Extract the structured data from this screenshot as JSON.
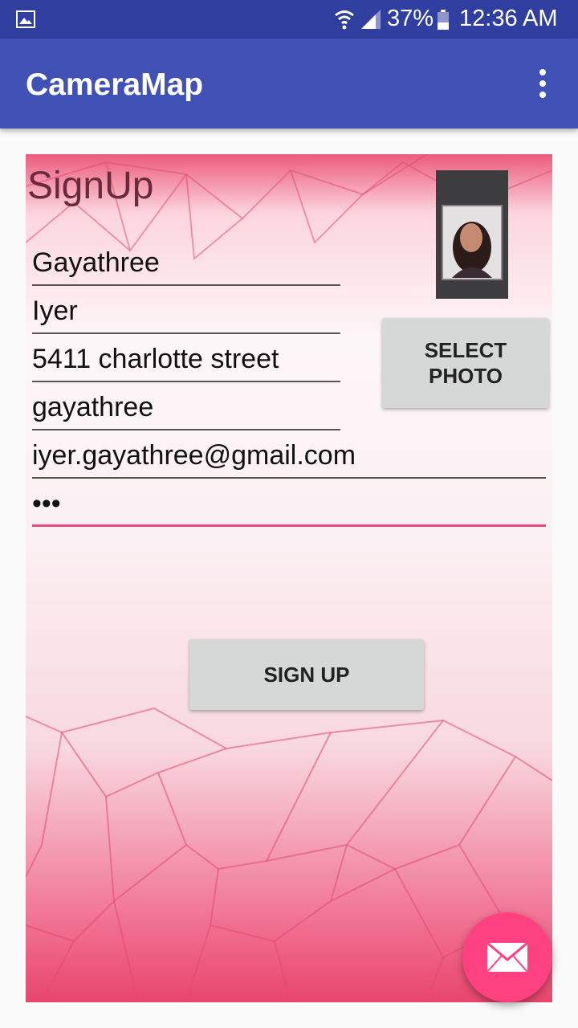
{
  "status_bar": {
    "battery_percent": "37%",
    "time": "12:36 AM",
    "icons": [
      "gallery-icon",
      "wifi-icon",
      "signal-icon",
      "battery-icon"
    ]
  },
  "app_bar": {
    "title": "CameraMap",
    "overflow_icon": "more-vert-icon"
  },
  "form": {
    "heading": "SignUp",
    "fields": {
      "first_name": "Gayathree",
      "last_name": "Iyer",
      "address": "5411 charlotte street",
      "username": "gayathree",
      "email": "iyer.gayathree@gmail.com",
      "password": "•••"
    },
    "select_photo_label_line1": "SELECT",
    "select_photo_label_line2": "PHOTO",
    "signup_label": "SIGN UP"
  },
  "fab": {
    "icon": "mail-icon"
  },
  "colors": {
    "status_bar": "#303f9f",
    "app_bar": "#3f51b5",
    "accent": "#ff4081",
    "button": "#d6d7d7"
  }
}
